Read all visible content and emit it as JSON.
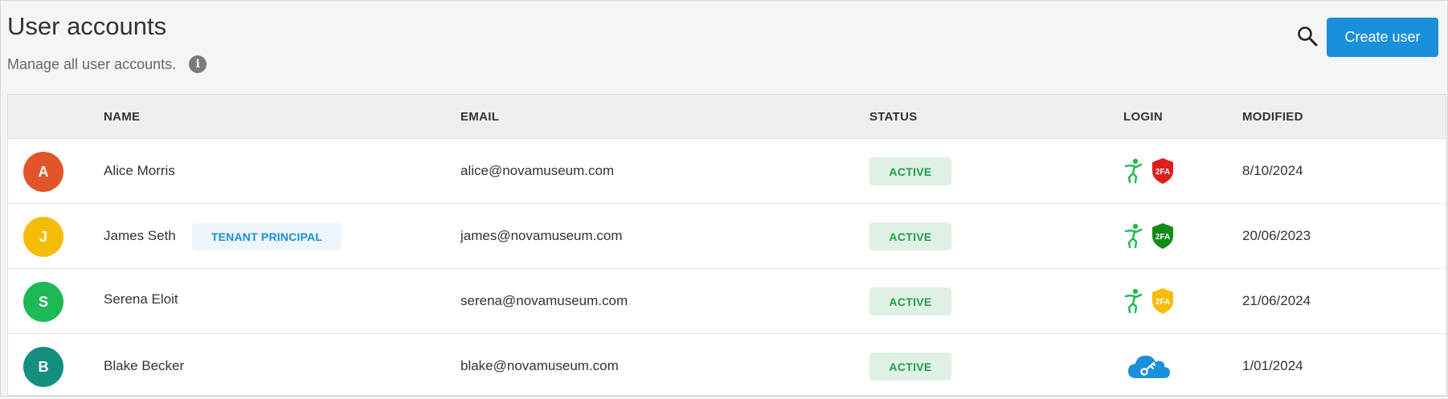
{
  "header": {
    "title": "User accounts",
    "subtitle": "Manage all user accounts.",
    "info_icon": "info-icon",
    "search_icon": "search-icon",
    "create_button": "Create user"
  },
  "table": {
    "columns": {
      "name": "NAME",
      "email": "EMAIL",
      "status": "STATUS",
      "login": "LOGIN",
      "modified": "MODIFIED"
    },
    "rows": [
      {
        "initial": "A",
        "avatar_color": "#e2552b",
        "name": "Alice Morris",
        "badge": "",
        "email": "alice@novamuseum.com",
        "status": "ACTIVE",
        "login_icons": [
          "sso-person-icon",
          "2fa-shield-red-icon"
        ],
        "twofa_label": "2FA",
        "modified": "8/10/2024"
      },
      {
        "initial": "J",
        "avatar_color": "#f5bd0a",
        "name": "James Seth",
        "badge": "TENANT PRINCIPAL",
        "email": "james@novamuseum.com",
        "status": "ACTIVE",
        "login_icons": [
          "sso-person-icon",
          "2fa-shield-green-icon"
        ],
        "twofa_label": "2FA",
        "modified": "20/06/2023"
      },
      {
        "initial": "S",
        "avatar_color": "#1db954",
        "name": "Serena Eloit",
        "badge": "",
        "email": "serena@novamuseum.com",
        "status": "ACTIVE",
        "login_icons": [
          "sso-person-icon",
          "2fa-shield-yellow-icon"
        ],
        "twofa_label": "2FA",
        "modified": "21/06/2024"
      },
      {
        "initial": "B",
        "avatar_color": "#138f80",
        "name": "Blake Becker",
        "badge": "",
        "email": "blake@novamuseum.com",
        "status": "ACTIVE",
        "login_icons": [
          "cloud-key-icon"
        ],
        "modified": "1/01/2024"
      }
    ]
  },
  "colors": {
    "accent": "#1a8fdb",
    "status_active_bg": "#dff1e4",
    "status_active_text": "#1e9e4a",
    "shield_red": "#e01d1d",
    "shield_green": "#118a1a",
    "shield_yellow": "#f5bd0a",
    "sso_green": "#1db954"
  }
}
